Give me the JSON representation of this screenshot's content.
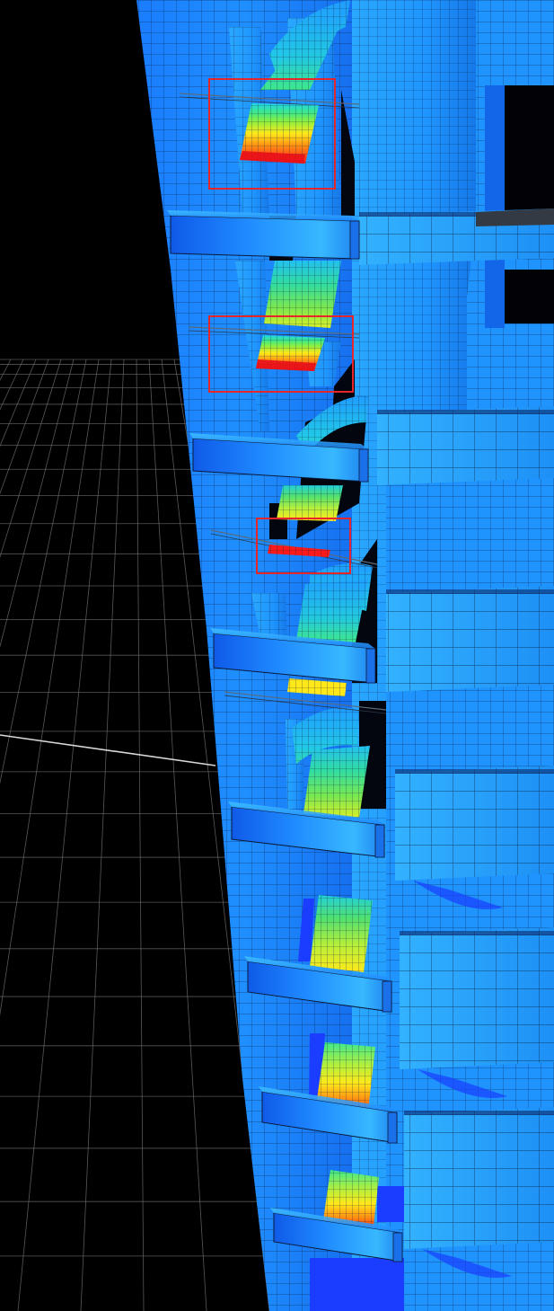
{
  "viewport": {
    "background_color": "#000000",
    "ground_grid_color": "#6e6e6e",
    "ground_axis_color": "#d8d8d8"
  },
  "model": {
    "mesh_line_color": "#0a1a3a",
    "low_stress_color": "#0a6cff",
    "mid_low_color": "#1fa0ff",
    "shell_color": "#1a8cff",
    "deep_color": "#1a3dff",
    "contour_scale": [
      "#1a40ff",
      "#1f9cff",
      "#22d6e8",
      "#3ee88a",
      "#b8f03a",
      "#ffe81a",
      "#ff8a12",
      "#ff1a1a"
    ]
  },
  "highlight": {
    "box_color": "#e6262b",
    "boxes": [
      {
        "name": "hotspot-upper"
      },
      {
        "name": "hotspot-middle"
      },
      {
        "name": "hotspot-lower"
      }
    ]
  },
  "stress_panels": [
    {
      "name": "panel-1",
      "peak": 1.0
    },
    {
      "name": "panel-2",
      "peak": 0.98
    },
    {
      "name": "panel-3",
      "peak": 0.6
    },
    {
      "name": "panel-4",
      "peak": 0.7
    },
    {
      "name": "panel-5",
      "peak": 0.5
    },
    {
      "name": "panel-6",
      "peak": 0.6
    },
    {
      "name": "panel-7",
      "peak": 0.85
    },
    {
      "name": "panel-8",
      "peak": 0.9
    }
  ]
}
